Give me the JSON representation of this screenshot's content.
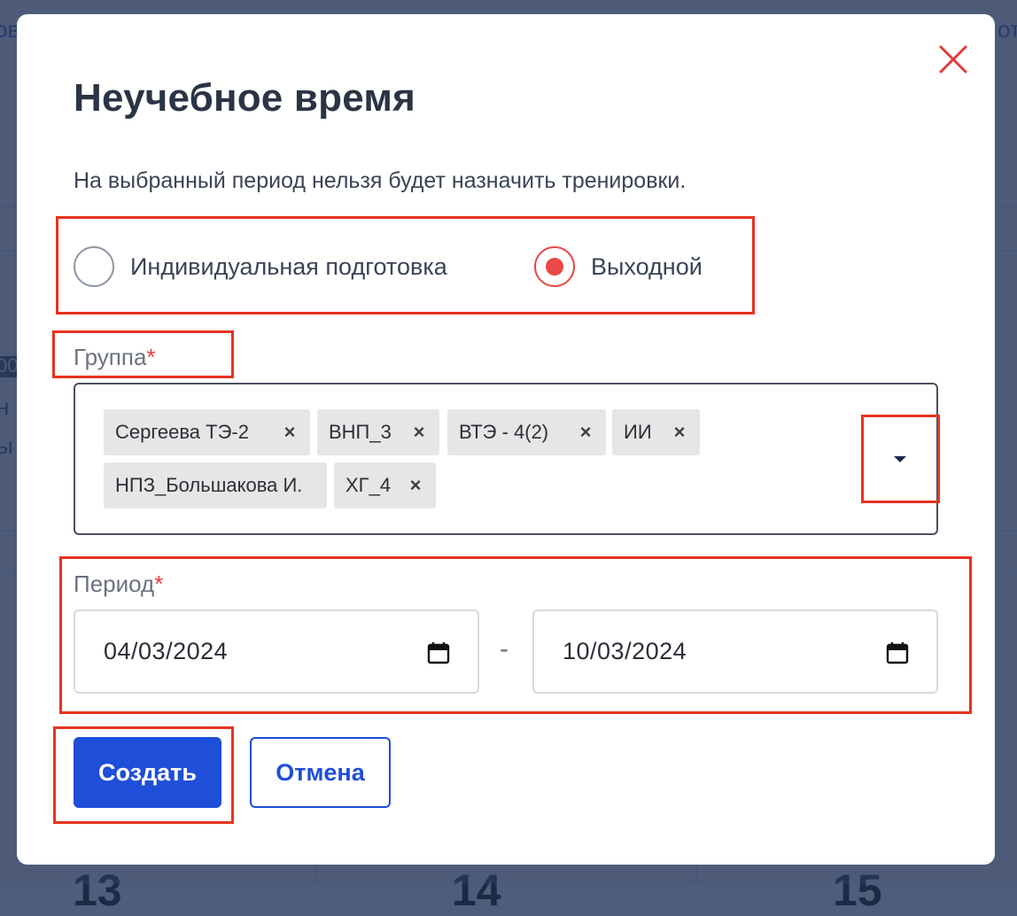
{
  "background": {
    "top_left_fragment": "ов",
    "top_right_fragment": "от",
    "left_fragments": [
      "00",
      "н",
      "ы"
    ],
    "bottom_numbers": [
      "13",
      "14",
      "15"
    ]
  },
  "modal": {
    "title": "Неучебное время",
    "description": "На выбранный период нельзя будет назначить тренировки.",
    "close_icon": "close-icon",
    "type_options": [
      {
        "label": "Индивидуальная подготовка",
        "selected": false
      },
      {
        "label": "Выходной",
        "selected": true
      }
    ],
    "group": {
      "label": "Группа",
      "required_mark": "*",
      "selected": [
        "Сергеева ТЭ-2",
        "ВНП_3",
        "ВТЭ - 4(2)",
        "ИИ",
        "НПЗ_Большакова И.",
        "ХГ_4"
      ],
      "remove_glyph": "×",
      "dropdown_icon": "caret-down-icon"
    },
    "period": {
      "label": "Период",
      "required_mark": "*",
      "from": "04/03/2024",
      "to": "10/03/2024",
      "separator": "-",
      "calendar_icon": "calendar-icon"
    },
    "buttons": {
      "create": "Создать",
      "cancel": "Отмена"
    }
  },
  "colors": {
    "primary": "#1f4ed8",
    "radio_selected": "#ea4747",
    "required": "#e83a3a",
    "close": "#e03b3b",
    "highlight": "#e8321e"
  }
}
